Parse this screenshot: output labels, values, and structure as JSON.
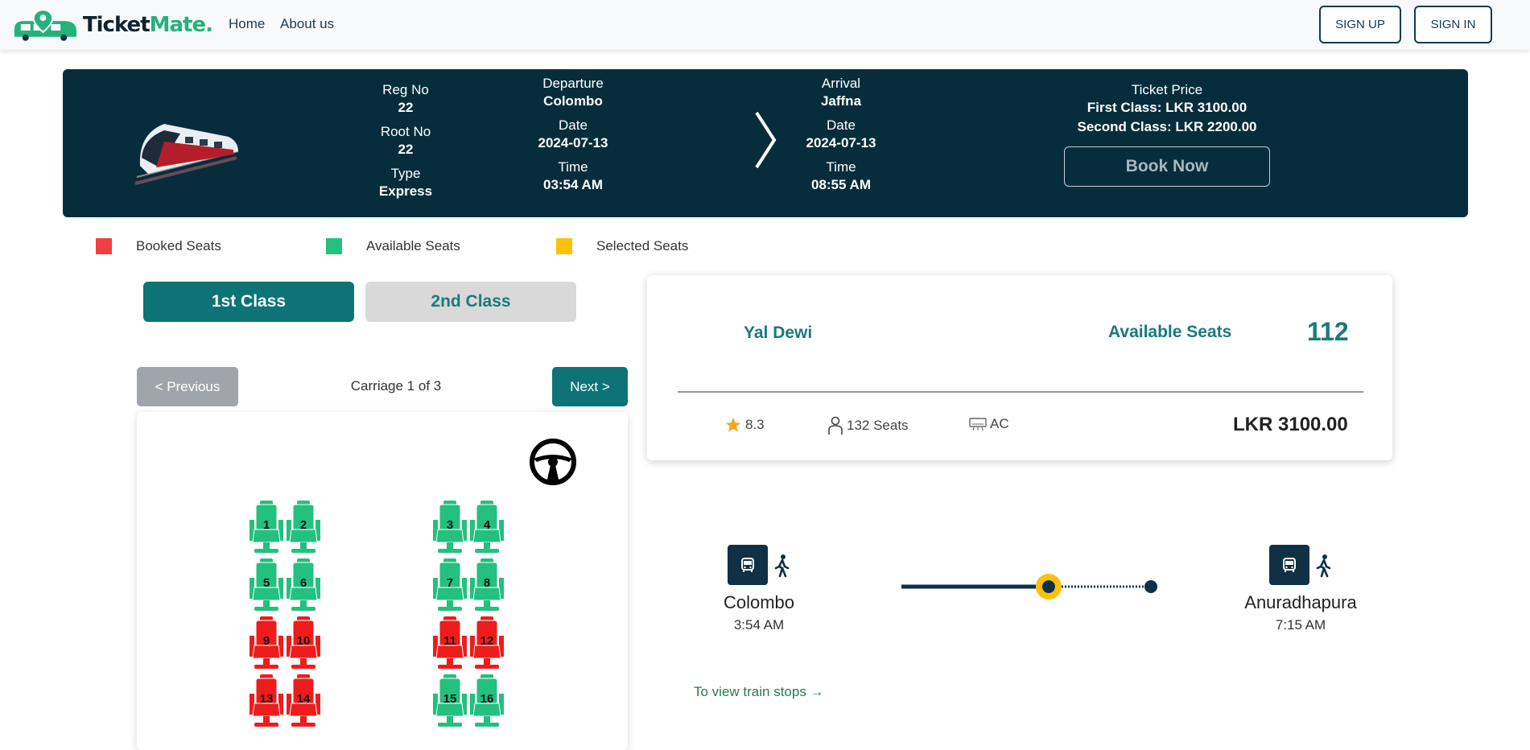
{
  "nav": {
    "brand_ticket": "Ticket",
    "brand_mate": "Mate",
    "brand_dot": ".",
    "links": [
      "Home",
      "About us"
    ],
    "signup": "SIGN UP",
    "signin": "SIGN IN"
  },
  "banner": {
    "reg_label": "Reg No",
    "reg_value": "22",
    "root_label": "Root No",
    "root_value": "22",
    "type_label": "Type",
    "type_value": "Express",
    "departure_label": "Departure",
    "departure_value": "Colombo",
    "dep_date_label": "Date",
    "dep_date_value": "2024-07-13",
    "dep_time_label": "Time",
    "dep_time_value": "03:54 AM",
    "arrival_label": "Arrival",
    "arrival_value": "Jaffna",
    "arr_date_label": "Date",
    "arr_date_value": "2024-07-13",
    "arr_time_label": "Time",
    "arr_time_value": "08:55 AM",
    "price_label": "Ticket Price",
    "first_class_price": "First Class: LKR 3100.00",
    "second_class_price": "Second Class: LKR 2200.00",
    "book_now": "Book Now"
  },
  "legend": {
    "booked": "Booked Seats",
    "available": "Available Seats",
    "selected": "Selected Seats",
    "booked_color": "#f04040",
    "available_color": "#23c07f",
    "selected_color": "#ffc107"
  },
  "classes": {
    "first": "1st Class",
    "second": "2nd Class",
    "active": "1st Class"
  },
  "pager": {
    "previous": "< Previous",
    "next": "Next >",
    "carriage": "Carriage 1 of 3"
  },
  "seats": [
    {
      "num": "1",
      "status": "available"
    },
    {
      "num": "2",
      "status": "available"
    },
    {
      "num": "3",
      "status": "available"
    },
    {
      "num": "4",
      "status": "available"
    },
    {
      "num": "5",
      "status": "available"
    },
    {
      "num": "6",
      "status": "available"
    },
    {
      "num": "7",
      "status": "available"
    },
    {
      "num": "8",
      "status": "available"
    },
    {
      "num": "9",
      "status": "booked"
    },
    {
      "num": "10",
      "status": "booked"
    },
    {
      "num": "11",
      "status": "booked"
    },
    {
      "num": "12",
      "status": "booked"
    },
    {
      "num": "13",
      "status": "booked"
    },
    {
      "num": "14",
      "status": "booked"
    },
    {
      "num": "15",
      "status": "available"
    },
    {
      "num": "16",
      "status": "available"
    }
  ],
  "info": {
    "train_name": "Yal Dewi",
    "available_label": "Available Seats",
    "available_count": "112",
    "rating": "8.3",
    "seats": "132 Seats",
    "ac": "AC",
    "price": "LKR 3100.00"
  },
  "route": {
    "from_name": "Colombo",
    "from_time": "3:54 AM",
    "to_name": "Anuradhapura",
    "to_time": "7:15 AM",
    "view_stops": "To view train stops →",
    "progress": 0.59
  },
  "icons": {
    "logo": "bus-pin-logo-icon",
    "train": "train-image-icon",
    "chevron": "chevron-right-icon",
    "wheel": "steering-wheel-icon",
    "star": "star-icon",
    "person": "person-icon",
    "ac": "ac-unit-icon",
    "bus": "bus-icon",
    "walk": "walking-person-icon"
  }
}
